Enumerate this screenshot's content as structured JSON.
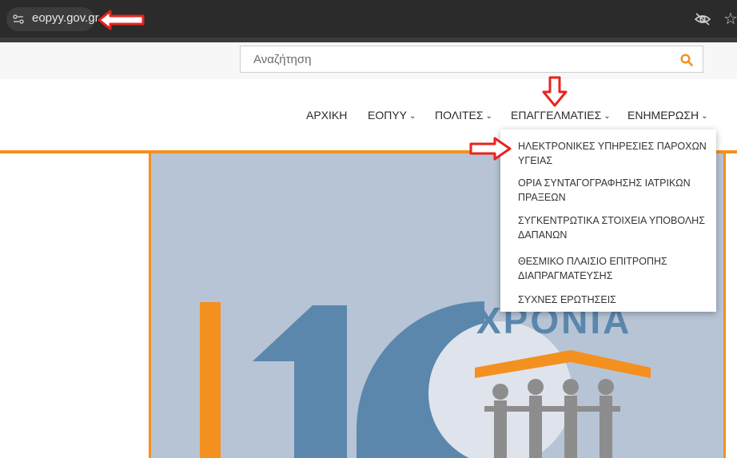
{
  "browser": {
    "url": "eopyy.gov.gr",
    "icons": [
      "site-settings-icon",
      "eye-off-icon",
      "star-icon"
    ]
  },
  "header": {
    "search": {
      "placeholder": "Αναζήτηση"
    }
  },
  "nav": {
    "items": [
      {
        "label": "ΑΡΧΙΚΗ"
      },
      {
        "label": "ΕΟΠΥΥ"
      },
      {
        "label": "ΠΟΛΙΤΕΣ"
      },
      {
        "label": "ΕΠΑΓΓΕΛΜΑΤΙΕΣ"
      },
      {
        "label": "ΕΝΗΜΕΡΩΣΗ"
      }
    ]
  },
  "dropdown": {
    "items": [
      {
        "label": "ΗΛΕΚΤΡΟΝΙΚΕΣ ΥΠΗΡΕΣΙΕΣ ΠΑΡΟΧΩΝ ΥΓΕΙΑΣ"
      },
      {
        "label": "ΟΡΙΑ ΣΥΝΤΑΓΟΓΡΑΦΗΣΗΣ ΙΑΤΡΙΚΩΝ ΠΡΑΞΕΩΝ"
      },
      {
        "label": "ΣΥΓΚΕΝΤΡΩΤΙΚΑ ΣΤΟΙΧΕΙΑ ΥΠΟΒΟΛΗΣ ΔΑΠΑΝΩΝ"
      },
      {
        "label": "ΘΕΣΜΙΚΟ ΠΛΑΙΣΙΟ ΕΠΙΤΡΟΠΗΣ ΔΙΑΠΡΑΓΜΑΤΕΥΣΗΣ"
      },
      {
        "label": "ΣΥΧΝΕΣ ΕΡΩΤΗΣΕΙΣ"
      }
    ]
  },
  "banner": {
    "text": "ΧΡΟΝΙΑ"
  },
  "colors": {
    "accent_orange": "#f39020",
    "annotation_red": "#e8231f",
    "banner_blue": "#5b87ad",
    "banner_bg": "#b6c4d5"
  }
}
